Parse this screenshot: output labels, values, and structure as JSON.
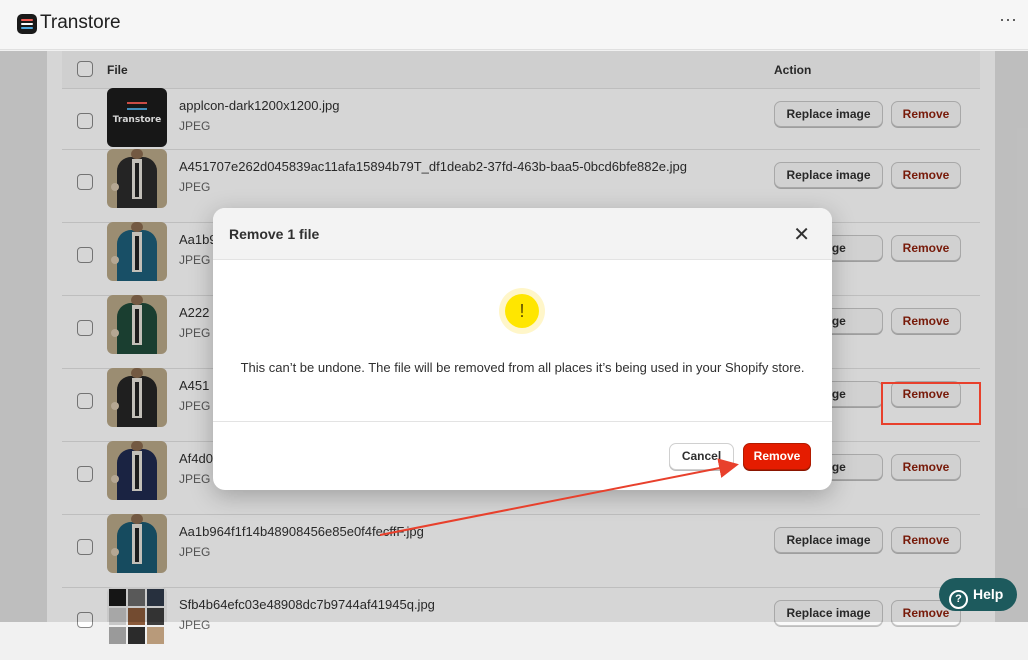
{
  "app": {
    "title": "Transtore",
    "more_icon": "ellipsis-icon",
    "logo_colors": [
      "#f25c54",
      "#4ea8de",
      "#ffffff"
    ]
  },
  "table": {
    "headers": {
      "file": "File",
      "action": "Action"
    },
    "rows": [
      {
        "name": "applcon-dark1200x1200.jpg",
        "type": "JPEG",
        "thumb": "logo",
        "thumb_text": "Transtore"
      },
      {
        "name": "A451707e262d045839ac11afa15894b79T_df1deab2-37fd-463b-baa5-0bcd6bfe882e.jpg",
        "type": "JPEG",
        "thumb": "suit",
        "color": "#2b2b2b"
      },
      {
        "name": "Aa1b9",
        "type": "JPEG",
        "thumb": "suit",
        "color": "#1d5f7a"
      },
      {
        "name": "A222",
        "type": "JPEG",
        "thumb": "suit",
        "color": "#1f4a3a"
      },
      {
        "name": "A451",
        "type": "JPEG",
        "thumb": "suit",
        "color": "#262626"
      },
      {
        "name": "Af4d0",
        "type": "JPEG",
        "thumb": "suit",
        "color": "#1f2a4f"
      },
      {
        "name": "Aa1b964f1f14b48908456e85e0f4fecffF.jpg",
        "type": "JPEG",
        "thumb": "suit",
        "color": "#1b5a72"
      },
      {
        "name": "Sfb4b64efc03e48908dc7b9744af41945q.jpg",
        "type": "JPEG",
        "thumb": "grid"
      }
    ],
    "replace_label": "Replace image",
    "replace_label_partial": "image",
    "remove_label": "Remove"
  },
  "modal": {
    "title": "Remove 1 file",
    "close_icon": "close-icon",
    "warning_icon": "!",
    "message": "This can’t be undone. The file will be removed from all places it’s being used in your Shopify store.",
    "cancel_label": "Cancel",
    "confirm_label": "Remove"
  },
  "help": {
    "label": "Help",
    "icon": "?"
  },
  "colors": {
    "accent_red": "#e51c00",
    "help_bg": "#1d5a5d",
    "annotation": "#e8402c"
  }
}
